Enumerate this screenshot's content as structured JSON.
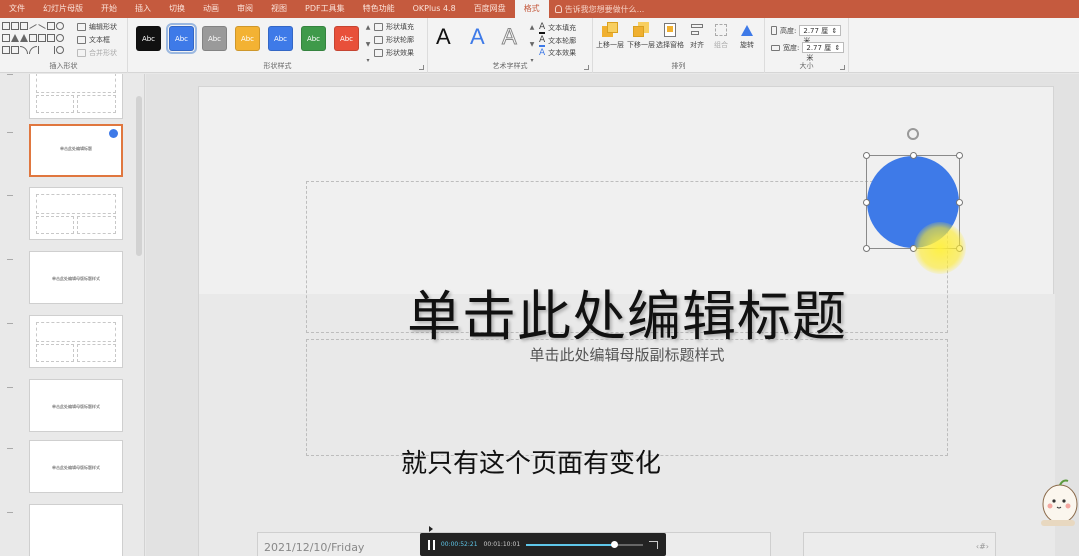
{
  "tabs": [
    {
      "label": "文件",
      "active": false
    },
    {
      "label": "幻灯片母版",
      "active": false
    },
    {
      "label": "开始",
      "active": false
    },
    {
      "label": "插入",
      "active": false
    },
    {
      "label": "切换",
      "active": false
    },
    {
      "label": "动画",
      "active": false
    },
    {
      "label": "审阅",
      "active": false
    },
    {
      "label": "视图",
      "active": false
    },
    {
      "label": "PDF工具集",
      "active": false
    },
    {
      "label": "特色功能",
      "active": false
    },
    {
      "label": "OKPlus 4.8",
      "active": false
    },
    {
      "label": "百度网盘",
      "active": false
    },
    {
      "label": "格式",
      "active": true
    }
  ],
  "tell_me": "告诉我您想要做什么...",
  "ribbon": {
    "insert_shapes": {
      "label": "插入形状",
      "edit_shape": "编辑形状",
      "text_box": "文本框",
      "merge_shapes": "合并形状"
    },
    "shape_styles": {
      "label": "形状样式",
      "swatches": [
        {
          "text": "Abc",
          "color": "#111111"
        },
        {
          "text": "Abc",
          "color": "#3e7ae8"
        },
        {
          "text": "Abc",
          "color": "#9a9a9a"
        },
        {
          "text": "Abc",
          "color": "#f3b233"
        },
        {
          "text": "Abc",
          "color": "#3e7ae8"
        },
        {
          "text": "Abc",
          "color": "#3f9a4a"
        },
        {
          "text": "Abc",
          "color": "#e8503a"
        }
      ],
      "fill": "形状填充",
      "outline": "形状轮廓",
      "effects": "形状效果"
    },
    "wordart": {
      "label": "艺术字样式",
      "letters": [
        "A",
        "A",
        "A"
      ],
      "text_fill": "文本填充",
      "text_outline": "文本轮廓",
      "text_effects": "文本效果"
    },
    "arrange": {
      "label": "排列",
      "bring_forward": "上移一层",
      "send_backward": "下移一层",
      "selection_pane": "选择窗格",
      "align": "对齐",
      "group": "组合",
      "rotate": "旋转"
    },
    "size": {
      "label": "大小",
      "height_label": "高度:",
      "height_value": "2.77 厘米",
      "width_label": "宽度:",
      "width_value": "2.77 厘米"
    }
  },
  "thumbnails": [
    {
      "text": ""
    },
    {
      "text": "单击此处编辑标题"
    },
    {
      "text": ""
    },
    {
      "text": "单击此处编辑母版标题样式"
    },
    {
      "text": ""
    },
    {
      "text": "单击此处编辑母版标题样式"
    },
    {
      "text": "单击此处编辑母版标题样式"
    },
    {
      "text": ""
    }
  ],
  "slide": {
    "title": "单击此处编辑标题",
    "subtitle": "单击此处编辑母版副标题样式",
    "caption": "就只有这个页面有变化",
    "date": "2021/12/10/Friday",
    "circle_color": "#3e7ae8"
  },
  "video": {
    "current": "00:00:52:21",
    "total": "00:01:10:01",
    "progress": 0.75
  }
}
